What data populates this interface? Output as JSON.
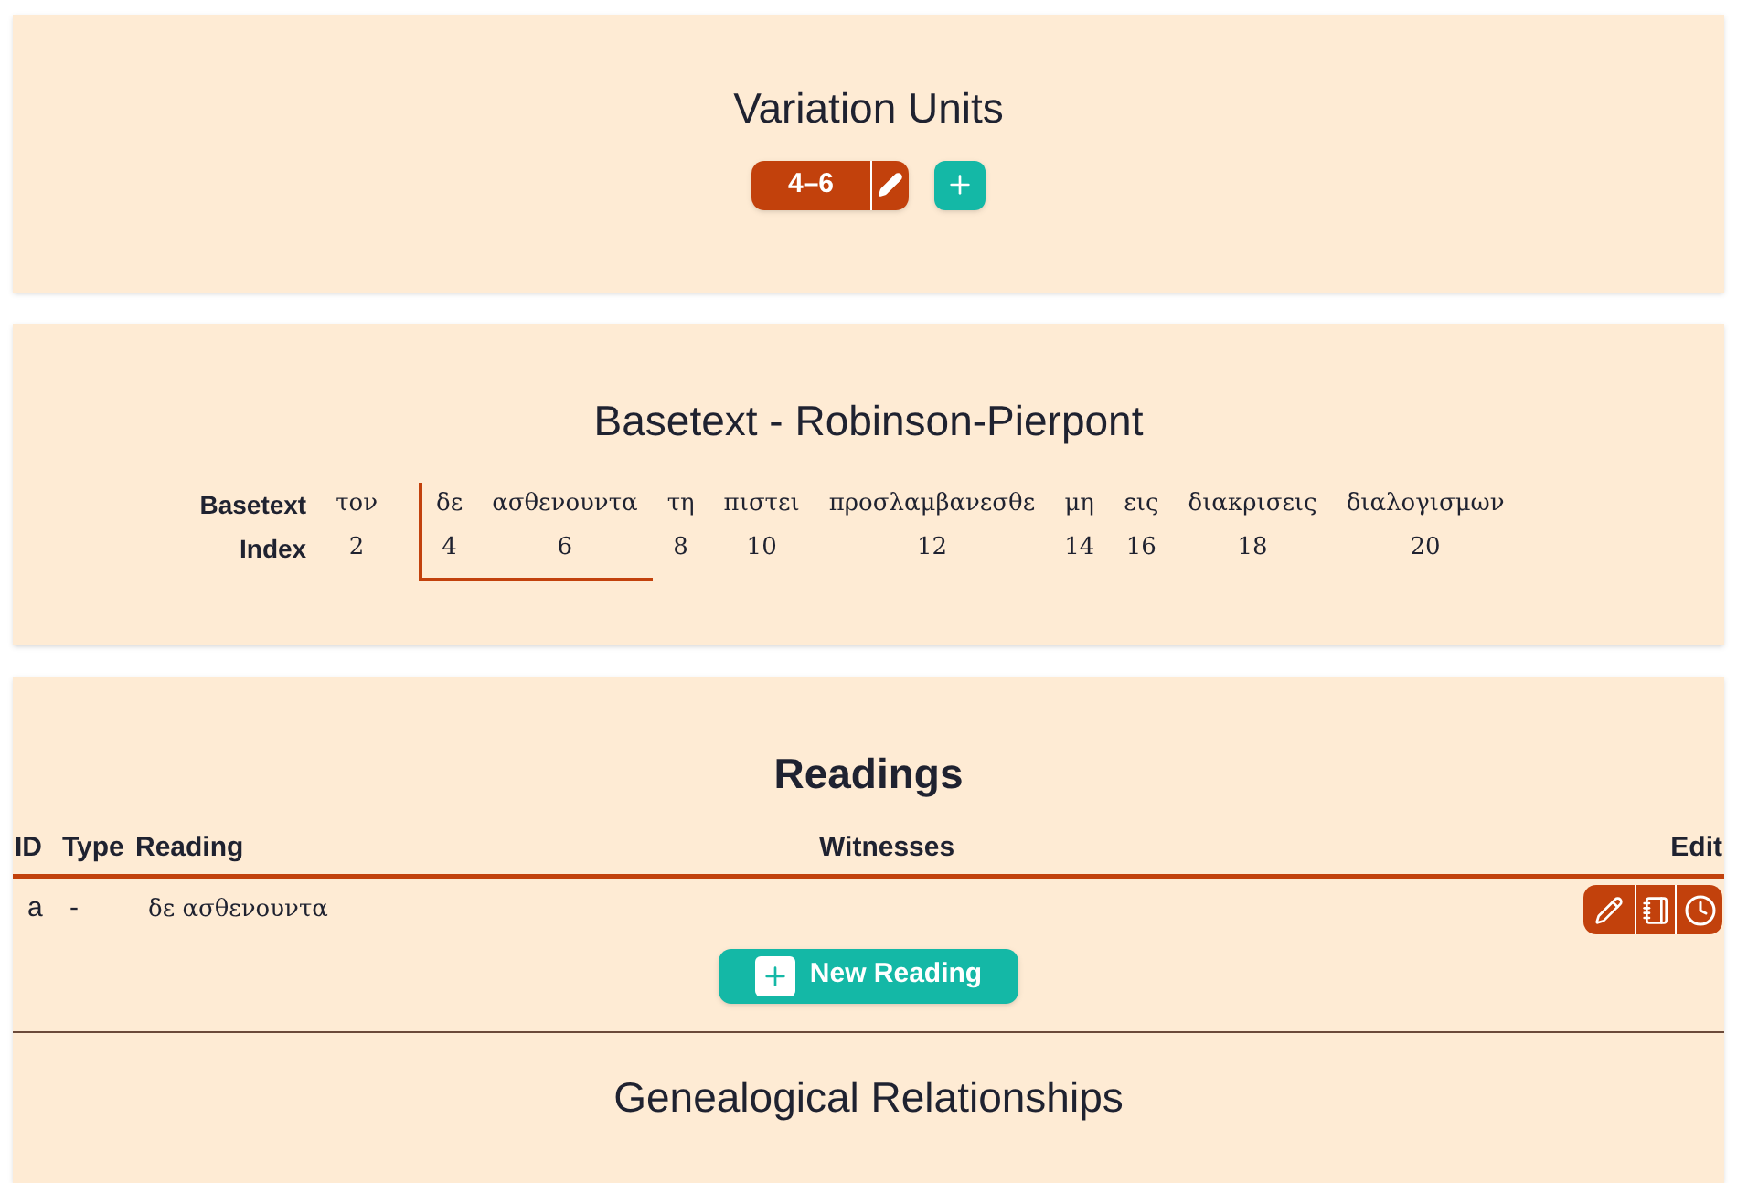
{
  "variation_units": {
    "title": "Variation Units",
    "units": [
      {
        "label": "4–6",
        "selected": true
      }
    ]
  },
  "basetext": {
    "title": "Basetext - Robinson-Pierpont",
    "row_labels": [
      "Basetext",
      "Index"
    ],
    "words": [
      {
        "word": "τον",
        "index": "2",
        "selected": false
      },
      {
        "word": "δε",
        "index": "4",
        "selected": true
      },
      {
        "word": "ασθενουντα",
        "index": "6",
        "selected": true
      },
      {
        "word": "τη",
        "index": "8",
        "selected": false
      },
      {
        "word": "πιστει",
        "index": "10",
        "selected": false
      },
      {
        "word": "προσλαμβανεσθε",
        "index": "12",
        "selected": false
      },
      {
        "word": "μη",
        "index": "14",
        "selected": false
      },
      {
        "word": "εις",
        "index": "16",
        "selected": false
      },
      {
        "word": "διακρισεις",
        "index": "18",
        "selected": false
      },
      {
        "word": "διαλογισμων",
        "index": "20",
        "selected": false
      }
    ]
  },
  "readings": {
    "title": "Readings",
    "columns": [
      "ID",
      "Type",
      "Reading",
      "Witnesses",
      "Edit"
    ],
    "rows": [
      {
        "id": "a",
        "type": "-",
        "reading": "δε ασθενουντα"
      }
    ],
    "new_button": "New Reading"
  },
  "genealogical": {
    "title": "Genealogical Relationships"
  }
}
